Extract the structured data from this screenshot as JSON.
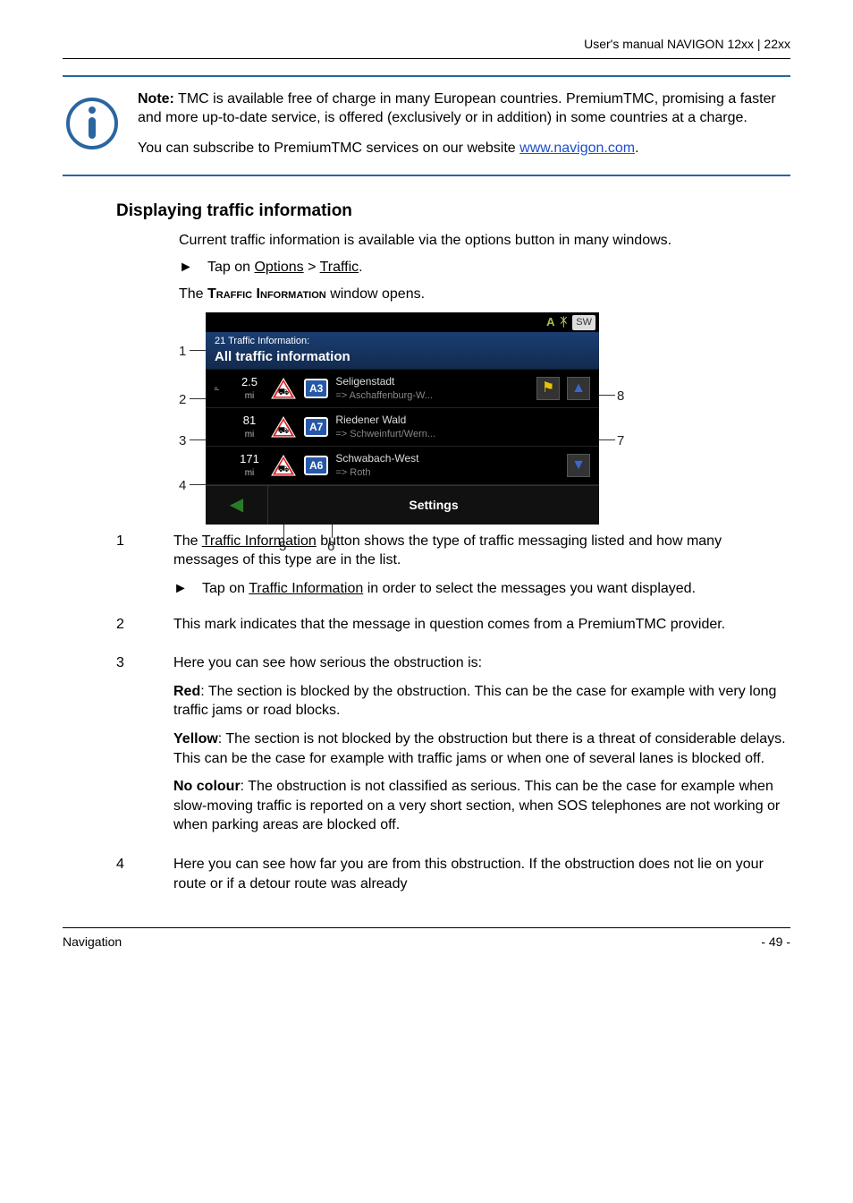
{
  "header": {
    "product": "User's manual NAVIGON 12xx | 22xx"
  },
  "note": {
    "p1_label": "Note:",
    "p1_rest": " TMC is available free of charge in many European countries. PremiumTMC, promising a faster and more up-to-date service, is offered (exclusively or in addition) in some countries at a charge.",
    "p2_lead": "You can subscribe to PremiumTMC services on our website ",
    "p2_link": "www.navigon.com",
    "p2_tail": "."
  },
  "section": {
    "title": "Displaying traffic information"
  },
  "intro": {
    "p1": "Current traffic information is available via the options button in many windows.",
    "bullet_lead": "Tap on ",
    "bullet_opt": "Options",
    "bullet_sep": " > ",
    "bullet_traffic": "Traffic",
    "bullet_end": ".",
    "p3_lead": "The ",
    "p3_caps": "Traffic Information",
    "p3_tail": " window opens."
  },
  "screen": {
    "topbar_sw": "SW",
    "header_small": "21 Traffic Information:",
    "header_big": "All traffic information",
    "rows": [
      {
        "premium_vis": true,
        "dist": "2.5",
        "unit": "mi",
        "road": "A3",
        "name": "Seligenstadt",
        "sub": "=> Aschaffenburg-W...",
        "dest": true,
        "arrow": "up"
      },
      {
        "premium_vis": false,
        "dist": "81",
        "unit": "mi",
        "road": "A7",
        "name": "Riedener Wald",
        "sub": "=> Schweinfurt/Wern...",
        "dest": false,
        "arrow": ""
      },
      {
        "premium_vis": false,
        "dist": "171",
        "unit": "mi",
        "road": "A6",
        "name": "Schwabach-West",
        "sub": "=> Roth",
        "dest": false,
        "arrow": "down"
      }
    ],
    "settings": "Settings"
  },
  "annot": {
    "n1": "1",
    "n2": "2",
    "n3": "3",
    "n4": "4",
    "n5": "5",
    "n6": "6",
    "n7": "7",
    "n8": "8"
  },
  "defs": {
    "d1_num": "1",
    "d1_p1a": "The ",
    "d1_p1b": "Traffic Information",
    "d1_p1c": " button shows the type of traffic messaging listed and how many messages of this type are in the list.",
    "d1_b_a": "Tap on ",
    "d1_b_b": "Traffic Information",
    "d1_b_c": " in order to select the messages you want displayed.",
    "d2_num": "2",
    "d2_t": "This mark indicates that the message in question comes from a PremiumTMC provider.",
    "d3_num": "3",
    "d3_lead": "Here you can see how serious the obstruction is:",
    "d3_red_l": "Red",
    "d3_red_t": ": The section is blocked by the obstruction. This can be the case for example with very long traffic jams or road blocks.",
    "d3_yel_l": "Yellow",
    "d3_yel_t": ": The section is not blocked by the obstruction but there is a threat of considerable delays. This can be the case for example with traffic jams or when one of several lanes is blocked off.",
    "d3_noc_l": "No colour",
    "d3_noc_t": ": The obstruction is not classified as serious. This can be the case for example when slow-moving traffic is reported on a very short section, when SOS telephones are not working or when parking areas are blocked off.",
    "d4_num": "4",
    "d4_t": "Here you can see how far you are from this obstruction. If the obstruction does not lie on your route or if a detour route was already"
  },
  "footer": {
    "left": "Navigation",
    "right": "- 49 -"
  }
}
